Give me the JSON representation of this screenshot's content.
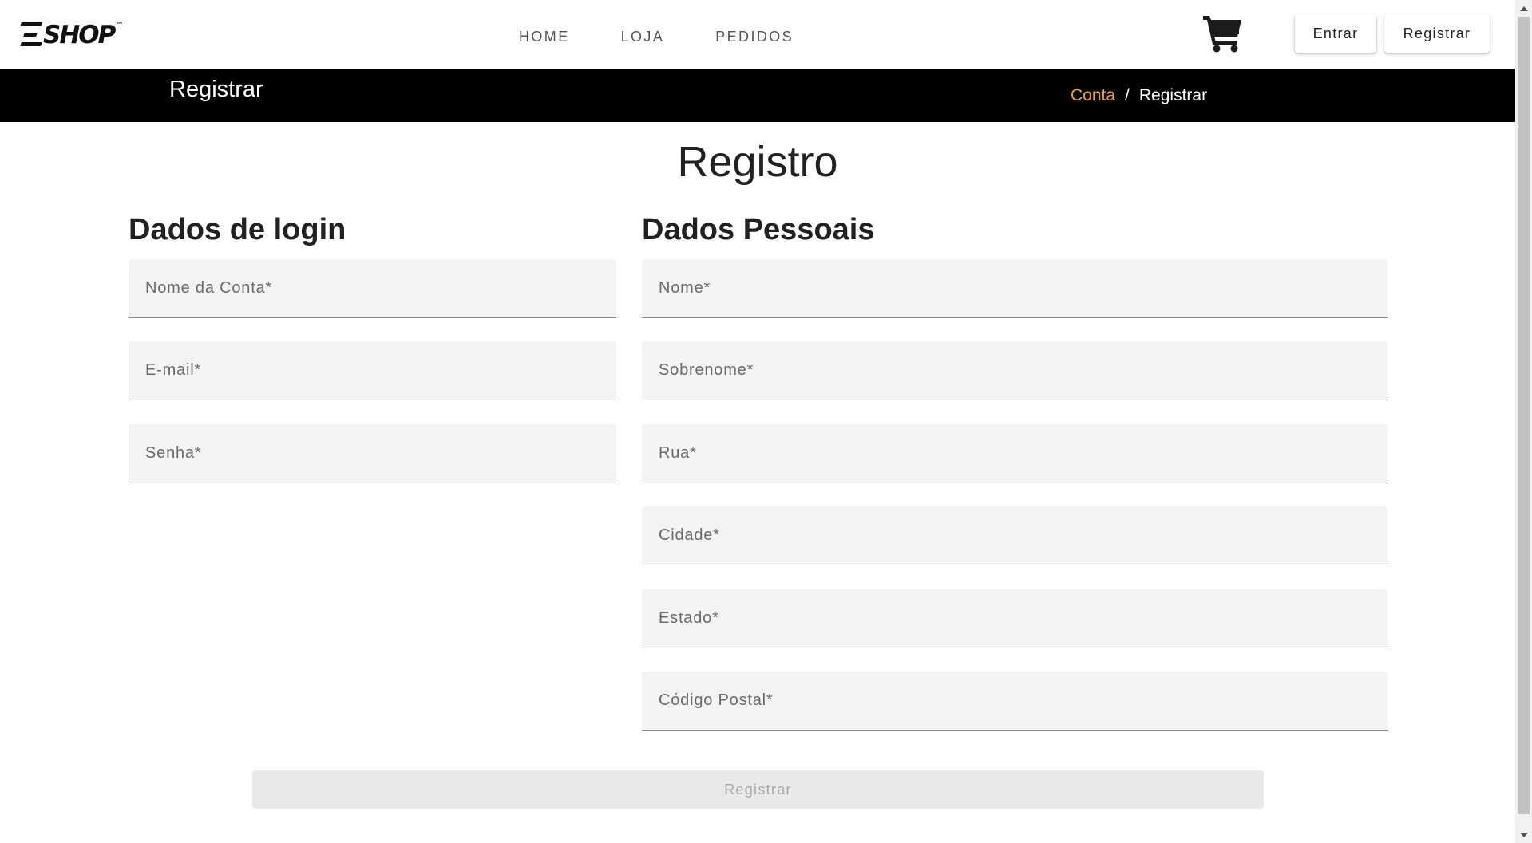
{
  "header": {
    "logo_text": "SHOP",
    "logo_tm": "™",
    "nav": [
      {
        "label": "HOME"
      },
      {
        "label": "LOJA"
      },
      {
        "label": "PEDIDOS"
      }
    ],
    "cart_icon": "shopping-cart-icon",
    "login_label": "Entrar",
    "register_label": "Registrar"
  },
  "banner": {
    "title": "Registrar",
    "breadcrumb": {
      "link": "Conta",
      "separator": "/",
      "current": "Registrar"
    },
    "link_color": "#f7a21b"
  },
  "main": {
    "title": "Registro",
    "login_section": {
      "title": "Dados de login",
      "fields": [
        {
          "placeholder": "Nome da Conta*",
          "value": ""
        },
        {
          "placeholder": "E-mail*",
          "value": ""
        },
        {
          "placeholder": "Senha*",
          "value": ""
        }
      ]
    },
    "personal_section": {
      "title": "Dados Pessoais",
      "fields": [
        {
          "placeholder": "Nome*",
          "value": ""
        },
        {
          "placeholder": "Sobrenome*",
          "value": ""
        },
        {
          "placeholder": "Rua*",
          "value": ""
        },
        {
          "placeholder": "Cidade*",
          "value": ""
        },
        {
          "placeholder": "Estado*",
          "value": ""
        },
        {
          "placeholder": "Código Postal*",
          "value": ""
        }
      ]
    },
    "submit_label": "Registrar",
    "submit_disabled": true
  }
}
